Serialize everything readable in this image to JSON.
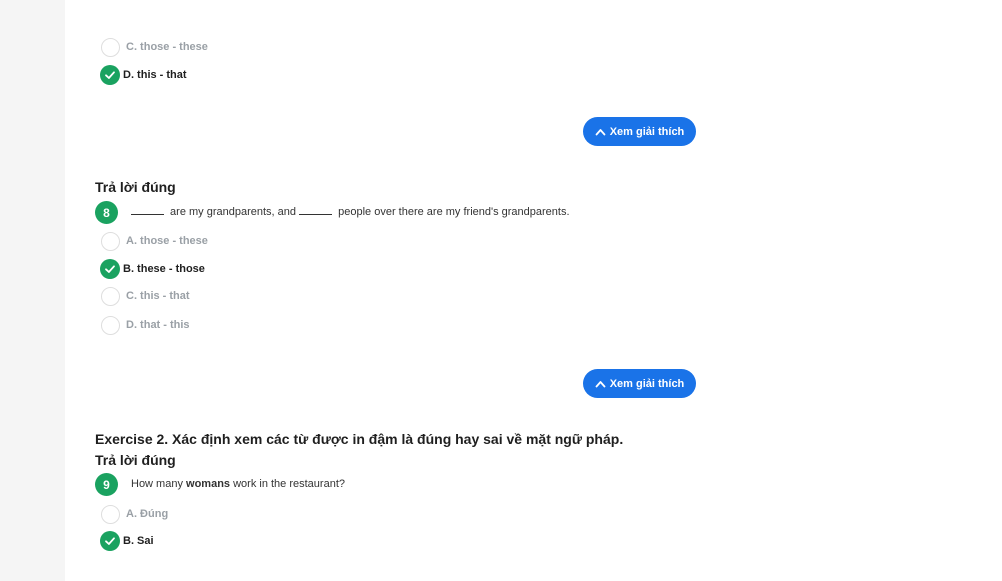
{
  "q7": {
    "options": [
      {
        "label": "C. those - these",
        "correct": false
      },
      {
        "label": "D. this - that",
        "correct": true
      }
    ],
    "explain_label": "Xem giải thích"
  },
  "q8": {
    "status": "Trả lời đúng",
    "number": "8",
    "text_part1": " are my grandparents, and ",
    "text_part2": " people over there are my friend's grandparents.",
    "options": [
      {
        "label": "A. those - these",
        "correct": false
      },
      {
        "label": "B. these - those",
        "correct": true
      },
      {
        "label": "C. this - that",
        "correct": false
      },
      {
        "label": "D. that - this",
        "correct": false
      }
    ],
    "explain_label": "Xem giải thích"
  },
  "exercise2": {
    "title": "Exercise 2. Xác định xem các từ được in đậm là đúng hay sai về mặt ngữ pháp."
  },
  "q9": {
    "status": "Trả lời đúng",
    "number": "9",
    "text_before": "How many ",
    "text_bold": "womans",
    "text_after": " work in the restaurant?",
    "options": [
      {
        "label": "A. Đúng",
        "correct": false
      },
      {
        "label": "B. Sai",
        "correct": true
      }
    ]
  },
  "colors": {
    "correct_green": "#1aa260",
    "button_blue": "#1a73e8",
    "muted_gray": "#9aa0a6"
  }
}
